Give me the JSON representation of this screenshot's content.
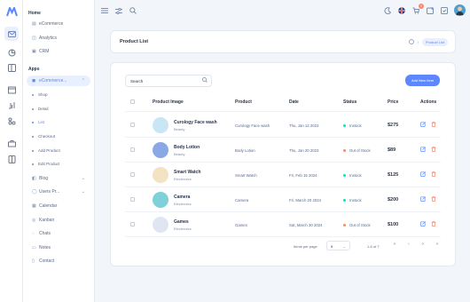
{
  "rail_icons": [
    "mail-icon",
    "chart-pie-icon",
    "layout-icon",
    "page-icon",
    "flask-icon",
    "apps-icon",
    "basket-icon",
    "book-icon"
  ],
  "sidebar": {
    "home_title": "Home",
    "home_items": [
      {
        "label": "eCommerce",
        "icon": "cart-icon"
      },
      {
        "label": "Analytics",
        "icon": "chart-icon"
      },
      {
        "label": "CRM",
        "icon": "crm-icon"
      }
    ],
    "apps_title": "Apps",
    "ecommerce_label": "eCommerce...",
    "ecommerce_sub": [
      "Shop",
      "Detail",
      "List",
      "Checkout",
      "Add Product",
      "Edit Product"
    ],
    "active_sub": "List",
    "apps_items": [
      {
        "label": "Blog",
        "icon": "blog-icon",
        "arrow": true
      },
      {
        "label": "Users Pr...",
        "icon": "user-icon",
        "arrow": true
      },
      {
        "label": "Calendar",
        "icon": "calendar-icon"
      },
      {
        "label": "Kanban",
        "icon": "kanban-icon"
      },
      {
        "label": "Chats",
        "icon": "chat-icon"
      },
      {
        "label": "Notes",
        "icon": "note-icon"
      },
      {
        "label": "Contact",
        "icon": "contact-icon"
      }
    ]
  },
  "topbar": {
    "cart_count": "0"
  },
  "header": {
    "title": "Product List",
    "breadcrumb_current": "Product List"
  },
  "toolbar": {
    "search_value": "Search",
    "add_label": "Add New Item"
  },
  "table": {
    "columns": [
      "Product Image",
      "Product",
      "Date",
      "Status",
      "Price",
      "Actions"
    ],
    "rows": [
      {
        "name": "Curology Face wash",
        "category": "Beauty",
        "product": "Curology Face wash",
        "date": "Thu, Jan 12 2023",
        "status": "Instock",
        "status_color": "#13deb9",
        "price": "$275",
        "img_color": "#c8e6f5"
      },
      {
        "name": "Body Lotion",
        "category": "Beauty",
        "product": "Body Lotion",
        "date": "Thu, Jan 20 2023",
        "status": "Out of Stock",
        "status_color": "#fa896b",
        "price": "$89",
        "img_color": "#8aa7e6"
      },
      {
        "name": "Smart Watch",
        "category": "Electronics",
        "product": "Smart Watch",
        "date": "Fri, Feb 15 2024",
        "status": "Instock",
        "status_color": "#13deb9",
        "price": "$125",
        "img_color": "#f3e3c3"
      },
      {
        "name": "Camera",
        "category": "Electronics",
        "product": "Camera",
        "date": "Fri, March 20 2024",
        "status": "Instock",
        "status_color": "#13deb9",
        "price": "$200",
        "img_color": "#7fd0d8"
      },
      {
        "name": "Games",
        "category": "Electronics",
        "product": "Games",
        "date": "Sat, March 30 2024",
        "status": "Out of Stock",
        "status_color": "#fa896b",
        "price": "$100",
        "img_color": "#dfe6f2"
      }
    ]
  },
  "pagination": {
    "items_per_page_label": "Items per page",
    "per_page": "5",
    "range": "1-5 of 7"
  },
  "colors": {
    "primary": "#5d87ff",
    "success": "#13deb9",
    "danger": "#fa896b"
  }
}
